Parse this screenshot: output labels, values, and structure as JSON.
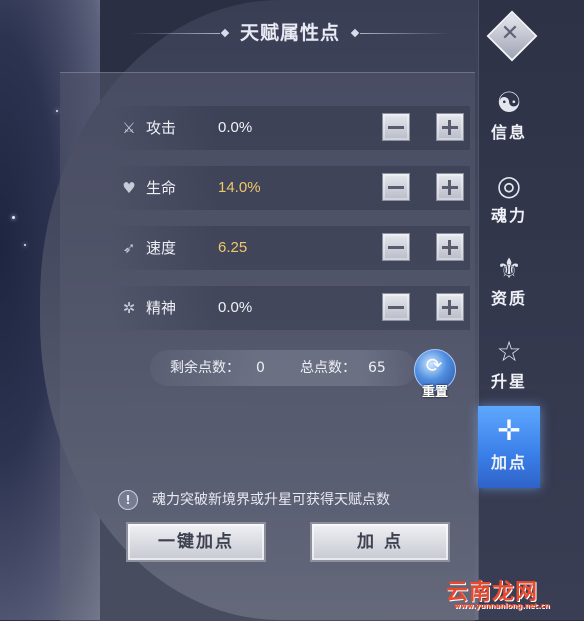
{
  "title": "天赋属性点",
  "stats": [
    {
      "icon": "sword-icon",
      "glyph": "⚔",
      "label": "攻击",
      "value": "0.0%",
      "value_color": "white"
    },
    {
      "icon": "heart-icon",
      "glyph": "♥",
      "label": "生命",
      "value": "14.0%",
      "value_color": "gold"
    },
    {
      "icon": "wing-icon",
      "glyph": "➶",
      "label": "速度",
      "value": "6.25",
      "value_color": "gold"
    },
    {
      "icon": "spirit-icon",
      "glyph": "✲",
      "label": "精神",
      "value": "0.0%",
      "value_color": "white"
    }
  ],
  "points": {
    "remaining_label": "剩余点数：",
    "remaining_value": "0",
    "total_label": "总点数：",
    "total_value": "65",
    "reset_label": "重置"
  },
  "hint": {
    "icon": "!",
    "text": "魂力突破新境界或升星可获得天赋点数"
  },
  "buttons": {
    "one_click": "一键加点",
    "add": "加 点"
  },
  "tabs": [
    {
      "label": "信息",
      "glyph": "☯",
      "icon": "info-emblem-icon",
      "active": false
    },
    {
      "label": "魂力",
      "glyph": "◎",
      "icon": "soul-power-icon",
      "active": false
    },
    {
      "label": "资质",
      "glyph": "⚜",
      "icon": "aptitude-icon",
      "active": false
    },
    {
      "label": "升星",
      "glyph": "☆",
      "icon": "star-up-icon",
      "active": false
    },
    {
      "label": "加点",
      "glyph": "✛",
      "icon": "add-point-icon",
      "active": true
    }
  ],
  "close_glyph": "✕",
  "watermark": {
    "text": "云南龙网",
    "sub": "www.yunnanlong.net.cn"
  },
  "colors": {
    "gold_value": "#f0c76a",
    "active_tab": "#3a7ee8",
    "watermark": "#e94a2e"
  }
}
